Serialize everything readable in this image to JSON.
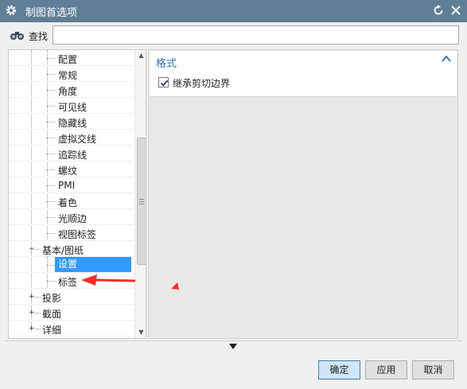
{
  "window": {
    "title": "制图首选项"
  },
  "search": {
    "label": "查找",
    "value": ""
  },
  "tree": {
    "items": [
      {
        "label": "配置",
        "level": 2
      },
      {
        "label": "常规",
        "level": 2
      },
      {
        "label": "角度",
        "level": 2
      },
      {
        "label": "可见线",
        "level": 2
      },
      {
        "label": "隐藏线",
        "level": 2
      },
      {
        "label": "虚拟交线",
        "level": 2
      },
      {
        "label": "追踪线",
        "level": 2
      },
      {
        "label": "螺纹",
        "level": 2
      },
      {
        "label": "PMI",
        "level": 2
      },
      {
        "label": "着色",
        "level": 2
      },
      {
        "label": "光顺边",
        "level": 2
      },
      {
        "label": "视图标签",
        "level": 2
      },
      {
        "label": "基本/图纸",
        "level": 1,
        "expander": "−"
      },
      {
        "label": "设置",
        "level": 2,
        "selected": true
      },
      {
        "label": "标签",
        "level": 2
      },
      {
        "label": "投影",
        "level": 1,
        "expander": "+"
      },
      {
        "label": "截面",
        "level": 1,
        "expander": "+"
      },
      {
        "label": "详细",
        "level": 1,
        "expander": "+"
      }
    ]
  },
  "right": {
    "group_title": "格式",
    "checkbox_label": "继承剪切边界",
    "checkbox_checked": true
  },
  "buttons": {
    "ok": "确定",
    "apply": "应用",
    "cancel": "取消"
  },
  "colors": {
    "titlebar": "#5f7f96",
    "selection": "#3399ff",
    "group_title": "#2b73b7",
    "annotation": "#ff2a2a"
  }
}
